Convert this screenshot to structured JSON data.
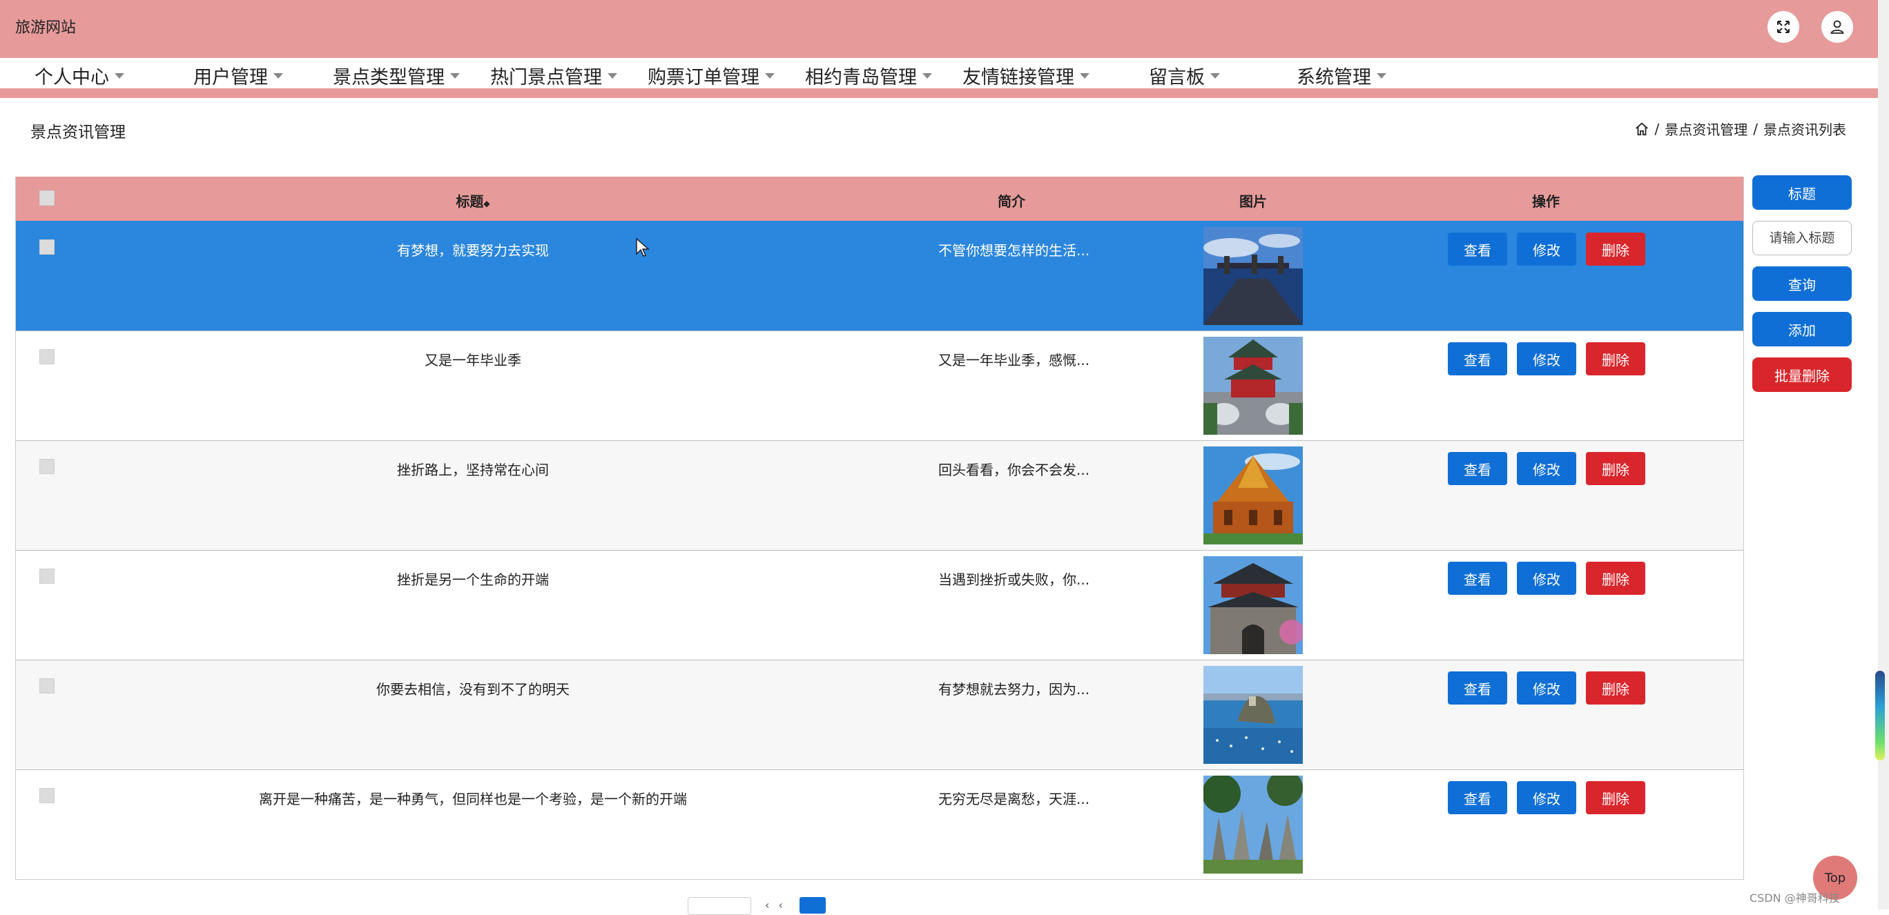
{
  "header": {
    "site_title": "旅游网站",
    "fullscreen_icon": "expand-arrows-icon",
    "user_icon": "user-icon"
  },
  "nav": [
    {
      "label": "个人中心"
    },
    {
      "label": "用户管理"
    },
    {
      "label": "景点类型管理"
    },
    {
      "label": "热门景点管理"
    },
    {
      "label": "购票订单管理"
    },
    {
      "label": "相约青岛管理"
    },
    {
      "label": "友情链接管理"
    },
    {
      "label": "留言板"
    },
    {
      "label": "系统管理"
    }
  ],
  "page": {
    "heading": "景点资讯管理",
    "breadcrumb": {
      "sep": "/",
      "items": [
        "景点资讯管理",
        "景点资讯列表"
      ]
    }
  },
  "table": {
    "columns": {
      "title": "标题",
      "sort_mark": "◆",
      "summary": "简介",
      "image": "图片",
      "actions": "操作"
    },
    "actions": {
      "view": "查看",
      "edit": "修改",
      "delete": "删除"
    },
    "rows": [
      {
        "title": "有梦想，就要努力去实现",
        "summary": "不管你想要怎样的生活...",
        "image": "pier-lake-photo",
        "selected": true
      },
      {
        "title": "又是一年毕业季",
        "summary": "又是一年毕业季，感慨...",
        "image": "temple-tower-photo",
        "selected": false
      },
      {
        "title": "挫折路上，坚持常在心间",
        "summary": "回头看看，你会不会发...",
        "image": "golden-temple-photo",
        "selected": false
      },
      {
        "title": "挫折是另一个生命的开端",
        "summary": "当遇到挫折或失败，你...",
        "image": "city-gate-photo",
        "selected": false
      },
      {
        "title": "你要去相信，没有到不了的明天",
        "summary": "有梦想就去努力，因为...",
        "image": "island-lake-photo",
        "selected": false
      },
      {
        "title": "离开是一种痛苦，是一种勇气，但同样也是一个考验，是一个新的开端",
        "summary": "无穷无尽是离愁，天涯...",
        "image": "stone-forest-photo",
        "selected": false
      }
    ]
  },
  "search": {
    "field_label": "标题",
    "placeholder": "请输入标题",
    "query_button": "查询",
    "add_button": "添加",
    "batch_delete_button": "批量删除"
  },
  "misc": {
    "top_button": "Top",
    "watermark": "CSDN @神哥科技"
  },
  "colors": {
    "header": "#e69a9a",
    "primary": "#0f6fd6",
    "danger": "#d9262c",
    "selected_row": "#2b86dd"
  }
}
